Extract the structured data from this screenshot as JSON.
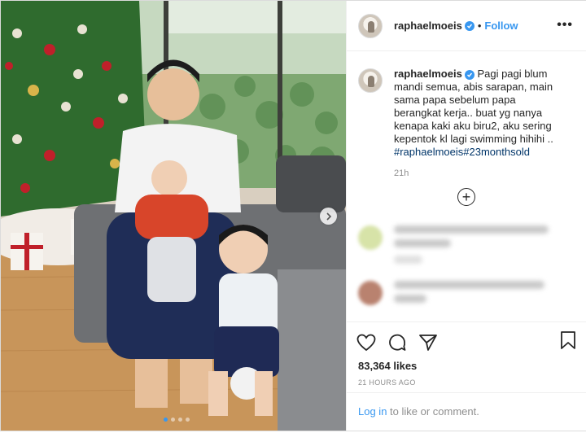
{
  "post": {
    "username": "raphaelmoeis",
    "follow_label": "Follow",
    "more_glyph": "•••",
    "caption_text": " Pagi pagi blum mandi semua, abis sarapan, main sama papa sebelum papa berangkat kerja.. buat yg nanya kenapa kaki aku biru2, aku sering kepentok kl lagi swimming hihihi ..",
    "hashtags": [
      "#raphaelmoeis",
      "#23monthsold"
    ],
    "caption_time": "21h",
    "load_more_glyph": "+",
    "likes": "83,364 likes",
    "posted_ago": "21 HOURS AGO",
    "login_link": "Log in",
    "login_suffix": " to like or comment."
  },
  "carousel": {
    "slide_count": 4,
    "active_index": 0
  },
  "colors": {
    "accent": "#3897f0",
    "text": "#262626",
    "muted": "#8e8e8e",
    "hashtag": "#003569",
    "border": "#efefef"
  },
  "icons": {
    "verified": "verified-badge-icon",
    "like": "heart-icon",
    "comment": "comment-bubble-icon",
    "share": "paper-plane-icon",
    "save": "bookmark-icon",
    "next": "chevron-right-icon",
    "more": "ellipsis-icon",
    "load_more": "plus-circle-icon"
  }
}
